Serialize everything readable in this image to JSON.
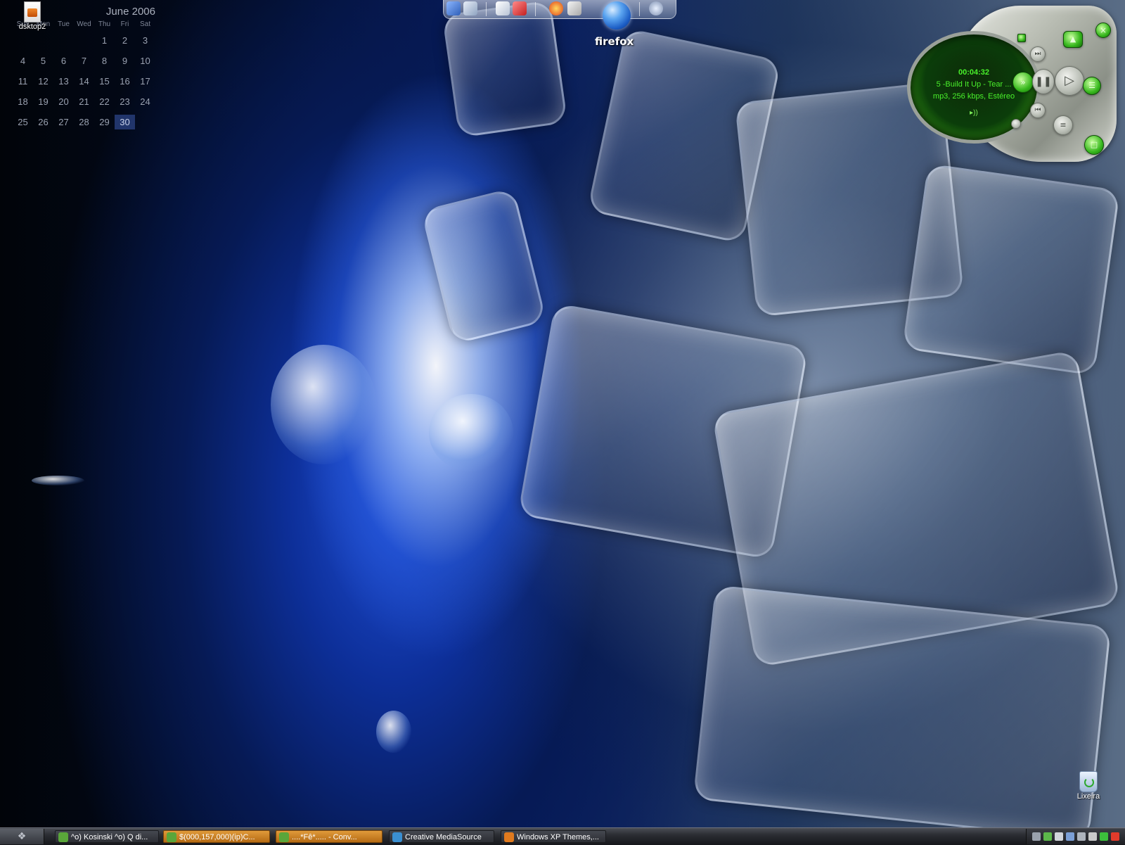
{
  "calendar": {
    "title": "June 2006",
    "weekdays": [
      "Sun",
      "Mon",
      "Tue",
      "Wed",
      "Thu",
      "Fri",
      "Sat"
    ],
    "weeks": [
      [
        "",
        "",
        "",
        "",
        "1",
        "2",
        "3"
      ],
      [
        "4",
        "5",
        "6",
        "7",
        "8",
        "9",
        "10"
      ],
      [
        "11",
        "12",
        "13",
        "14",
        "15",
        "16",
        "17"
      ],
      [
        "18",
        "19",
        "20",
        "21",
        "22",
        "23",
        "24"
      ],
      [
        "25",
        "26",
        "27",
        "28",
        "29",
        "30",
        ""
      ]
    ],
    "today": "30"
  },
  "desktop_icons": {
    "dsktop2": "dsktop2",
    "recycle_bin": "Lixeira"
  },
  "dock": {
    "label": "firefox",
    "items": [
      "monitor-icon",
      "network-icon",
      "document-icon",
      "calendar-icon",
      "browser-icon",
      "mail-icon",
      "firefox-icon",
      "clock-icon"
    ]
  },
  "player": {
    "time": "00:04:32",
    "track": "5 -Build It Up - Tear ...",
    "info": "mp3, 256 kbps, Estéreo",
    "accent": "#49f02b"
  },
  "taskbar": {
    "tasks": [
      {
        "label": "^o) Kosinski ^o) Q di...",
        "icon": "chat-icon",
        "flash": false
      },
      {
        "label": "$(000,157,000)(ip)C...",
        "icon": "chat-icon",
        "flash": true
      },
      {
        "label": "....*Fê*..... - Conv...",
        "icon": "chat-icon",
        "flash": true
      },
      {
        "label": "Creative MediaSource",
        "icon": "media-icon",
        "flash": false
      },
      {
        "label": "Windows XP Themes,...",
        "icon": "firefox-icon",
        "flash": false
      }
    ],
    "tray_icons": [
      "network-tray-icon",
      "messenger-tray-icon",
      "user-tray-icon",
      "display-tray-icon",
      "device-tray-icon",
      "media-tray-icon",
      "antivirus-tray-icon",
      "ati-tray-icon"
    ]
  }
}
